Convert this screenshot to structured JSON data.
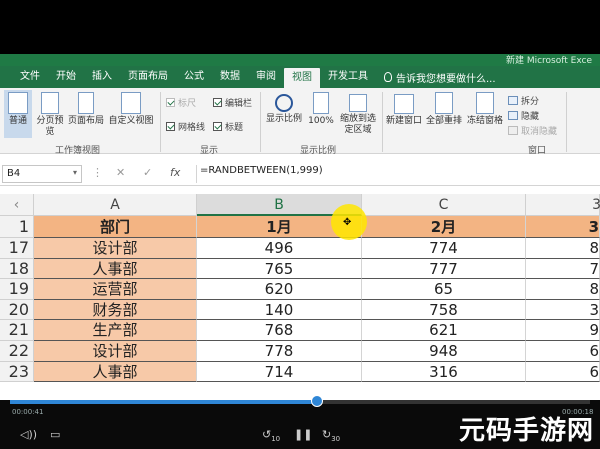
{
  "window": {
    "app_title_partial": "新建 Microsoft Exce"
  },
  "ribbon_tabs": [
    "文件",
    "开始",
    "插入",
    "页面布局",
    "公式",
    "数据",
    "审阅",
    "视图",
    "开发工具"
  ],
  "active_tab": "视图",
  "tell_me": "告诉我您想要做什么...",
  "groups": {
    "workbook_views": {
      "label": "工作簿视图",
      "buttons": [
        "普通",
        "分页预览",
        "页面布局",
        "自定义视图"
      ]
    },
    "show": {
      "label": "显示",
      "checks": [
        {
          "label": "标尺",
          "checked": true,
          "disabled": true
        },
        {
          "label": "编辑栏",
          "checked": true,
          "disabled": false
        },
        {
          "label": "网格线",
          "checked": true,
          "disabled": false
        },
        {
          "label": "标题",
          "checked": true,
          "disabled": false
        }
      ]
    },
    "zoom": {
      "label": "显示比例",
      "buttons": [
        "显示比例",
        "100%",
        "缩放到选定区域"
      ]
    },
    "window": {
      "label": "窗口",
      "buttons": [
        "新建窗口",
        "全部重排",
        "冻结窗格"
      ],
      "small": [
        {
          "label": "拆分",
          "disabled": false
        },
        {
          "label": "隐藏",
          "disabled": false
        },
        {
          "label": "取消隐藏",
          "disabled": true
        }
      ]
    }
  },
  "formula_bar": {
    "name_box": "B4",
    "formula": "=RANDBETWEEN(1,999)"
  },
  "columns": [
    "A",
    "B",
    "C",
    "3"
  ],
  "header_row": {
    "row": "1",
    "cells": [
      "部门",
      "1月",
      "2月",
      "3"
    ]
  },
  "rows": [
    {
      "row": "17",
      "dept": "设计部",
      "b": "496",
      "c": "774",
      "d": "8"
    },
    {
      "row": "18",
      "dept": "人事部",
      "b": "765",
      "c": "777",
      "d": "7"
    },
    {
      "row": "19",
      "dept": "运营部",
      "b": "620",
      "c": "65",
      "d": "8"
    },
    {
      "row": "20",
      "dept": "财务部",
      "b": "140",
      "c": "758",
      "d": "3"
    },
    {
      "row": "21",
      "dept": "生产部",
      "b": "768",
      "c": "621",
      "d": "9"
    },
    {
      "row": "22",
      "dept": "设计部",
      "b": "778",
      "c": "948",
      "d": "6"
    },
    {
      "row": "23",
      "dept": "人事部",
      "b": "714",
      "c": "316",
      "d": "6"
    }
  ],
  "player": {
    "elapsed": "00:00:41",
    "total": "00:00:18",
    "progress": 0.53,
    "rewind_label": "10",
    "forward_label": "30"
  },
  "watermark": "元码手游网"
}
